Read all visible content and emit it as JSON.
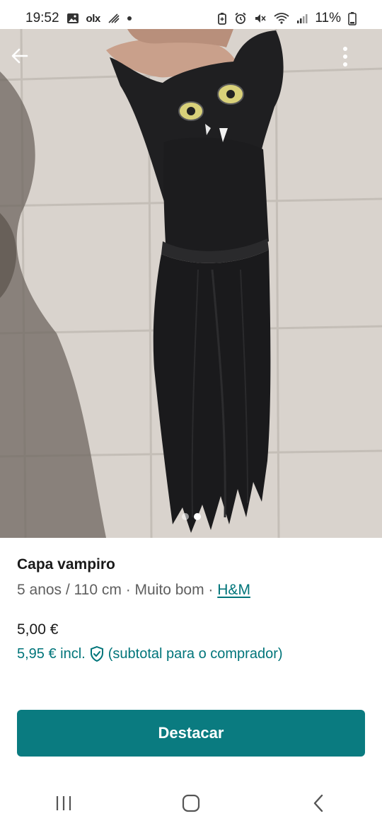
{
  "status_bar": {
    "time": "19:52",
    "battery": "11%",
    "left_icons": [
      "gallery-icon",
      "olx-icon",
      "data-saver-icon",
      "dot-icon"
    ],
    "olx_label": "olx",
    "right_icons": [
      "battery-saver-icon",
      "alarm-icon",
      "mute-icon",
      "wifi-icon",
      "signal-icon",
      "battery-icon"
    ]
  },
  "photo": {
    "pages": 2,
    "active_page": 2,
    "back_icon": "arrow-left-icon",
    "menu_icon": "more-vertical-icon"
  },
  "listing": {
    "title": "Capa vampiro",
    "size": "5 anos / 110 cm",
    "separator": " · ",
    "condition": "Muito bom",
    "brand": "H&M",
    "price": "5,00 €",
    "price_incl": "5,95 € incl.",
    "price_incl_note": "(subtotal para o comprador)",
    "shield_icon": "shield-check-icon"
  },
  "actions": {
    "primary_label": "Destacar"
  },
  "nav_bar": {
    "icons": [
      "recent-apps-icon",
      "home-icon",
      "back-icon"
    ]
  },
  "colors": {
    "accent": "#0a7b80",
    "link": "#00757a"
  }
}
